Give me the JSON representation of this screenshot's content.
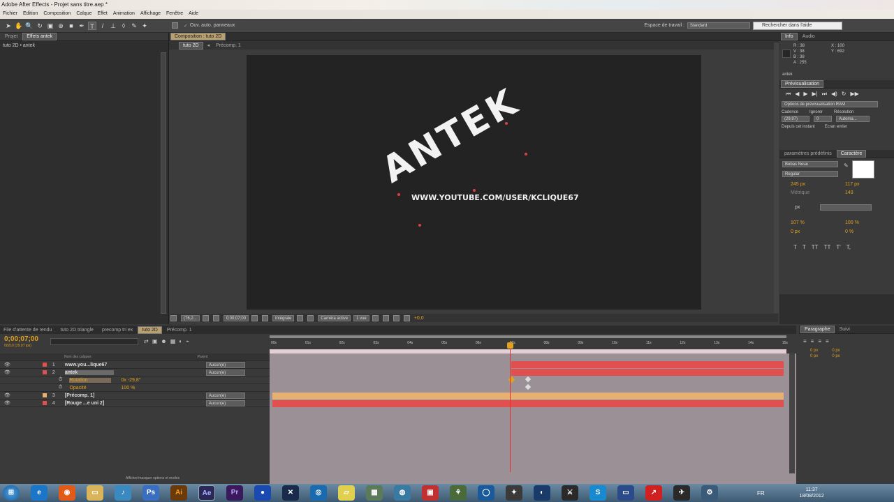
{
  "window": {
    "title": "Adobe After Effects - Projet sans titre.aep *"
  },
  "menu": [
    "Fichier",
    "Edition",
    "Composition",
    "Calque",
    "Effet",
    "Animation",
    "Affichage",
    "Fenêtre",
    "Aide"
  ],
  "toolbar": {
    "auto_panels": "Ouv. auto. panneaux",
    "workspace_label": "Espace de travail :",
    "workspace_value": "Standard",
    "search_placeholder": "Rechercher dans l'aide"
  },
  "project_panel": {
    "tabs": [
      "Projet",
      "Effets antek"
    ],
    "breadcrumb": "tuto 2D • antek"
  },
  "composition_panel": {
    "tab": "Composition : tuto 2D",
    "breadcrumbs": [
      "tuto 2D",
      "Précomp. 1"
    ],
    "footer": {
      "zoom": "(76,2...",
      "time": "0;00;07;00",
      "resolution": "Intégrale",
      "camera": "Caméra active",
      "views": "1 vue",
      "exposure": "+0,0"
    }
  },
  "canvas": {
    "title_text": "ANTEK",
    "url_text": "WWW.YOUTUBE.COM/USER/KCLIQUE67"
  },
  "info_panel": {
    "tabs": [
      "Info",
      "Audio"
    ],
    "r": "R : 38",
    "g": "V : 38",
    "b": "B : 38",
    "a": "A : 255",
    "x": "X : 100",
    "y": "Y : 692",
    "layer": "antek"
  },
  "preview_panel": {
    "title": "Prévisualisation",
    "ram_options": "Options de prévisualisation RAM",
    "cadence_label": "Cadence",
    "ignore_label": "Ignorer",
    "res_label": "Résolution",
    "cadence_value": "(29,97)",
    "ignore_value": "0",
    "res_value": "Automa...",
    "from_current": "Depuis cet instant",
    "full_screen": "Ecran entier"
  },
  "character_panel": {
    "tabs": [
      "paramètres prédéfinis",
      "Caractère"
    ],
    "font": "Bebas Neue",
    "style": "Regular",
    "size": "245 px",
    "leading": "117 px",
    "kerning": "Métrique",
    "tracking": "149",
    "stroke": "px",
    "vscale": "107 %",
    "hscale": "100 %",
    "baseline": "0 px",
    "tsume": "0 %"
  },
  "paragraph_panel": {
    "tabs": [
      "Paragraphe",
      "Suivi"
    ],
    "v1": "0 px",
    "v2": "0 px",
    "v3": "0 px",
    "v4": "0 px",
    "v5": "0 px"
  },
  "timeline": {
    "tabs": [
      "File d'attente de rendu",
      "tuto 2D triangle",
      "precomp tri ex",
      "tuto 2D",
      "Précomp. 1"
    ],
    "timecode": "0;00;07;00",
    "fps": "00210 (29.97 ips)",
    "search_placeholder": "",
    "col_name": "Nom des calques",
    "col_parent": "Parent",
    "ruler": [
      "00s",
      "01s",
      "02s",
      "03s",
      "04s",
      "05s",
      "06s",
      "07s",
      "08s",
      "09s",
      "10s",
      "11s",
      "12s",
      "13s",
      "14s",
      "15s"
    ],
    "layers": [
      {
        "num": "1",
        "name": "www.you...lique67",
        "parent": "Aucun(e)",
        "color": "#e05050"
      },
      {
        "num": "2",
        "name": "antek",
        "parent": "Aucun(e)",
        "color": "#e05050"
      },
      {
        "num": "3",
        "name": "[Précomp. 1]",
        "parent": "Aucun(e)",
        "color": "#e8b070"
      },
      {
        "num": "4",
        "name": "[Rouge ...e uni 2]",
        "parent": "Aucun(e)",
        "color": "#e05050"
      }
    ],
    "props": [
      {
        "name": "Rotation",
        "value": "0x -29,8°"
      },
      {
        "name": "Opacité",
        "value": "100 %"
      }
    ],
    "footer": "Afficher/masquer options et modes"
  },
  "taskbar": {
    "lang": "FR",
    "time": "11:37",
    "date": "18/08/2012"
  },
  "colors": {
    "accent": "#e0a020",
    "layer_red": "#e05050",
    "layer_tan": "#e8b070"
  }
}
